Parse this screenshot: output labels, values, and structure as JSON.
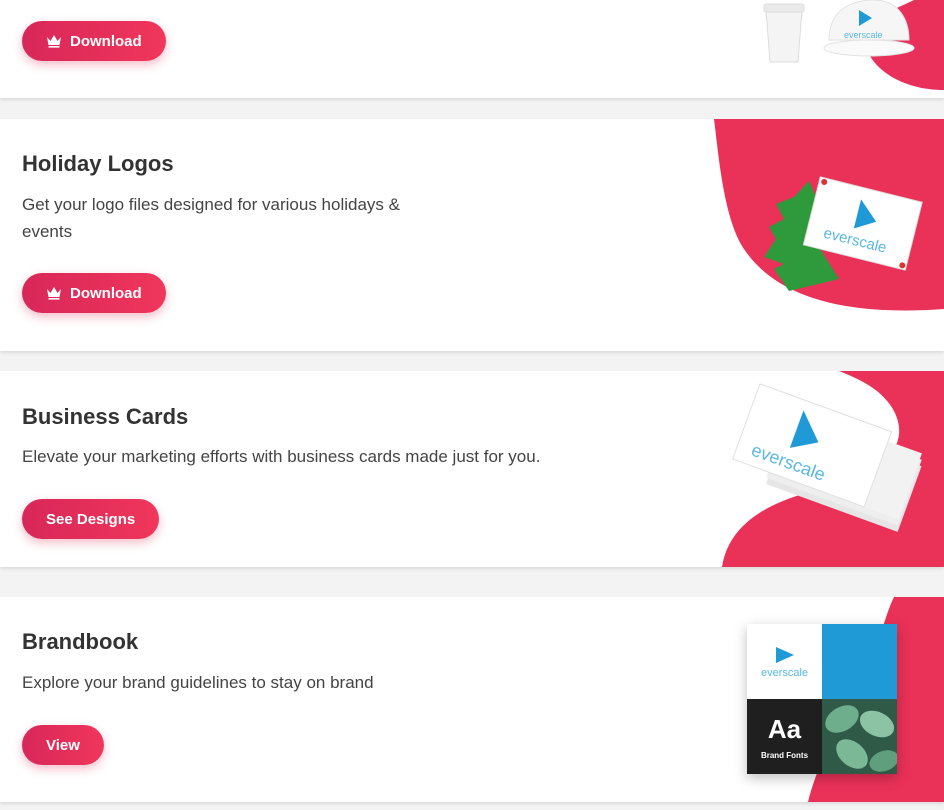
{
  "cards": [
    {
      "button": "Download",
      "button_icon": "crown-icon"
    },
    {
      "title": "Holiday Logos",
      "desc_line1": "Get your logo files designed for various holidays &",
      "desc_line2": "events",
      "button": "Download",
      "button_icon": "crown-icon"
    },
    {
      "title": "Business Cards",
      "desc": "Elevate your marketing efforts with business cards made just for you.",
      "button": "See Designs"
    },
    {
      "title": "Brandbook",
      "desc": "Explore your brand guidelines to stay on brand",
      "button": "View"
    }
  ],
  "brand": {
    "logo_text": "everscale",
    "fonts_sample": "Aa",
    "fonts_label": "Brand Fonts"
  },
  "colors": {
    "accent": "#e8305a",
    "accent_dark": "#d8275a",
    "logo_blue": "#1f9ad6"
  }
}
